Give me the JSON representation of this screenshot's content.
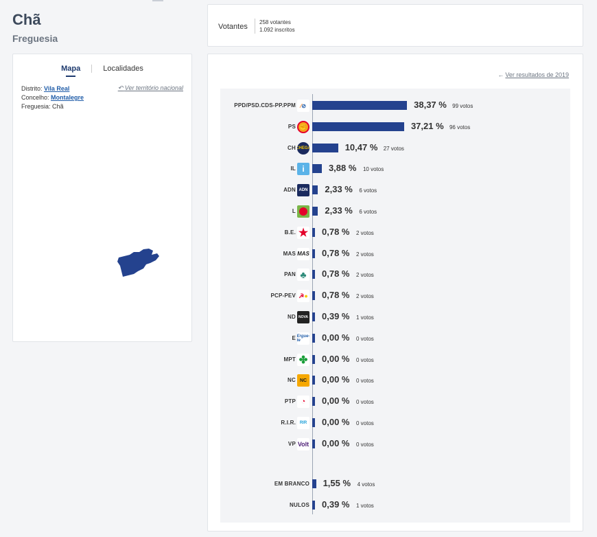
{
  "header": {
    "title": "Chã",
    "subtitle": "Freguesia"
  },
  "left_panel": {
    "tabs": [
      "Mapa",
      "Localidades"
    ],
    "distrito_label": "Distrito:",
    "distrito_value": "Vila Real",
    "concelho_label": "Concelho:",
    "concelho_value": "Montalegre",
    "freguesia_label": "Freguesia:",
    "freguesia_value": "Chã",
    "back_link": "Ver território nacional"
  },
  "voters": {
    "label": "Votantes",
    "votantes": "258 votantes",
    "inscritos": "1.092 inscritos"
  },
  "results": {
    "prev_link": "Ver resultados de 2019",
    "rows": [
      {
        "name": "PPD/PSD.CDS-PP.PPM",
        "pct_value": 38.37,
        "pct": "38,37 %",
        "votes": "99 votos",
        "logo": "ad-logo"
      },
      {
        "name": "PS",
        "pct_value": 37.21,
        "pct": "37,21 %",
        "votes": "96 votos",
        "logo": "ps-logo"
      },
      {
        "name": "CH",
        "pct_value": 10.47,
        "pct": "10,47 %",
        "votes": "27 votos",
        "logo": "chega-logo"
      },
      {
        "name": "IL",
        "pct_value": 3.88,
        "pct": "3,88 %",
        "votes": "10 votos",
        "logo": "il-logo"
      },
      {
        "name": "ADN",
        "pct_value": 2.33,
        "pct": "2,33 %",
        "votes": "6 votos",
        "logo": "adn-logo"
      },
      {
        "name": "L",
        "pct_value": 2.33,
        "pct": "2,33 %",
        "votes": "6 votos",
        "logo": "livre-logo"
      },
      {
        "name": "B.E.",
        "pct_value": 0.78,
        "pct": "0,78 %",
        "votes": "2 votos",
        "logo": "be-logo"
      },
      {
        "name": "MAS",
        "pct_value": 0.78,
        "pct": "0,78 %",
        "votes": "2 votos",
        "logo": "mas-logo"
      },
      {
        "name": "PAN",
        "pct_value": 0.78,
        "pct": "0,78 %",
        "votes": "2 votos",
        "logo": "pan-logo"
      },
      {
        "name": "PCP-PEV",
        "pct_value": 0.78,
        "pct": "0,78 %",
        "votes": "2 votos",
        "logo": "cdu-logo"
      },
      {
        "name": "ND",
        "pct_value": 0.39,
        "pct": "0,39 %",
        "votes": "1 votos",
        "logo": "nd-logo"
      },
      {
        "name": "E",
        "pct_value": 0.0,
        "pct": "0,00 %",
        "votes": "0 votos",
        "logo": "ergue-te-logo"
      },
      {
        "name": "MPT",
        "pct_value": 0.0,
        "pct": "0,00 %",
        "votes": "0 votos",
        "logo": "mpt-logo"
      },
      {
        "name": "NC",
        "pct_value": 0.0,
        "pct": "0,00 %",
        "votes": "0 votos",
        "logo": "nc-logo"
      },
      {
        "name": "PTP",
        "pct_value": 0.0,
        "pct": "0,00 %",
        "votes": "0 votos",
        "logo": "ptp-logo"
      },
      {
        "name": "R.I.R.",
        "pct_value": 0.0,
        "pct": "0,00 %",
        "votes": "0 votos",
        "logo": "rir-logo"
      },
      {
        "name": "VP",
        "pct_value": 0.0,
        "pct": "0,00 %",
        "votes": "0 votos",
        "logo": "volt-logo"
      }
    ],
    "special_rows": [
      {
        "name": "EM BRANCO",
        "pct_value": 1.55,
        "pct": "1,55 %",
        "votes": "4 votos"
      },
      {
        "name": "NULOS",
        "pct_value": 0.39,
        "pct": "0,39 %",
        "votes": "1 votos"
      }
    ]
  },
  "colors": {
    "bar": "#24428e",
    "title": "#3d4a5c",
    "link": "#1f5ca8"
  }
}
